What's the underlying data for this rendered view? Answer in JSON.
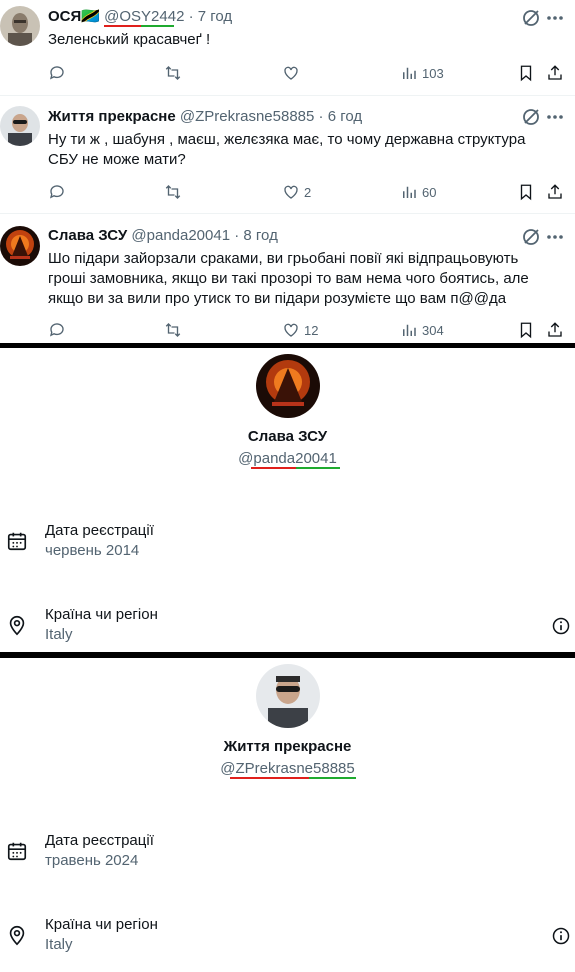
{
  "tweets": [
    {
      "name": "ОСЯ🇹🇿",
      "handle": "@OSY2442",
      "time": "7 год",
      "text": "Зеленський красавчеґ !",
      "replies": "",
      "reposts": "",
      "likes": "",
      "views": "103"
    },
    {
      "name": "Життя прекрасне",
      "handle": "@ZPrekrasne58885",
      "time": "6 год",
      "text": "Ну ти ж , шабуня , маєш, желєзяка має, то чому державна структура СБУ не може мати?",
      "replies": "",
      "reposts": "",
      "likes": "2",
      "views": "60"
    },
    {
      "name": "Слава ЗСУ",
      "handle": "@panda20041",
      "time": "8 год",
      "text": "Шо підари зайорзали сраками, ви грьобані повії які відпрацьовують гроші замовника, якщо ви такі прозорі то вам нема чого боятись, але якщо ви за вили про утиск то ви підари розумієте що вам п@@да",
      "replies": "",
      "reposts": "",
      "likes": "12",
      "views": "304"
    }
  ],
  "dot": "·",
  "profiles": [
    {
      "name": "Слава ЗСУ",
      "handle": "@panda20041",
      "joined_label": "Дата реєстрації",
      "joined_value": "червень 2014",
      "country_label": "Країна чи регіон",
      "country_value": "Italy"
    },
    {
      "name": "Життя прекрасне",
      "handle": "@ZPrekrasne58885",
      "joined_label": "Дата реєстрації",
      "joined_value": "травень 2024",
      "country_label": "Країна чи регіон",
      "country_value": "Italy"
    }
  ],
  "icons": {
    "reply": "reply-icon",
    "repost": "repost-icon",
    "like": "like-icon",
    "views": "views-icon",
    "bookmark": "bookmark-icon",
    "share": "share-icon",
    "grok": "grok-icon",
    "more": "more-icon",
    "calendar": "calendar-icon",
    "location": "location-icon",
    "info": "info-icon"
  },
  "colors": {
    "underline_red": "#e0201c",
    "underline_green": "#1faa2f",
    "secondary_text": "#536471",
    "primary_text": "#0f1419"
  }
}
